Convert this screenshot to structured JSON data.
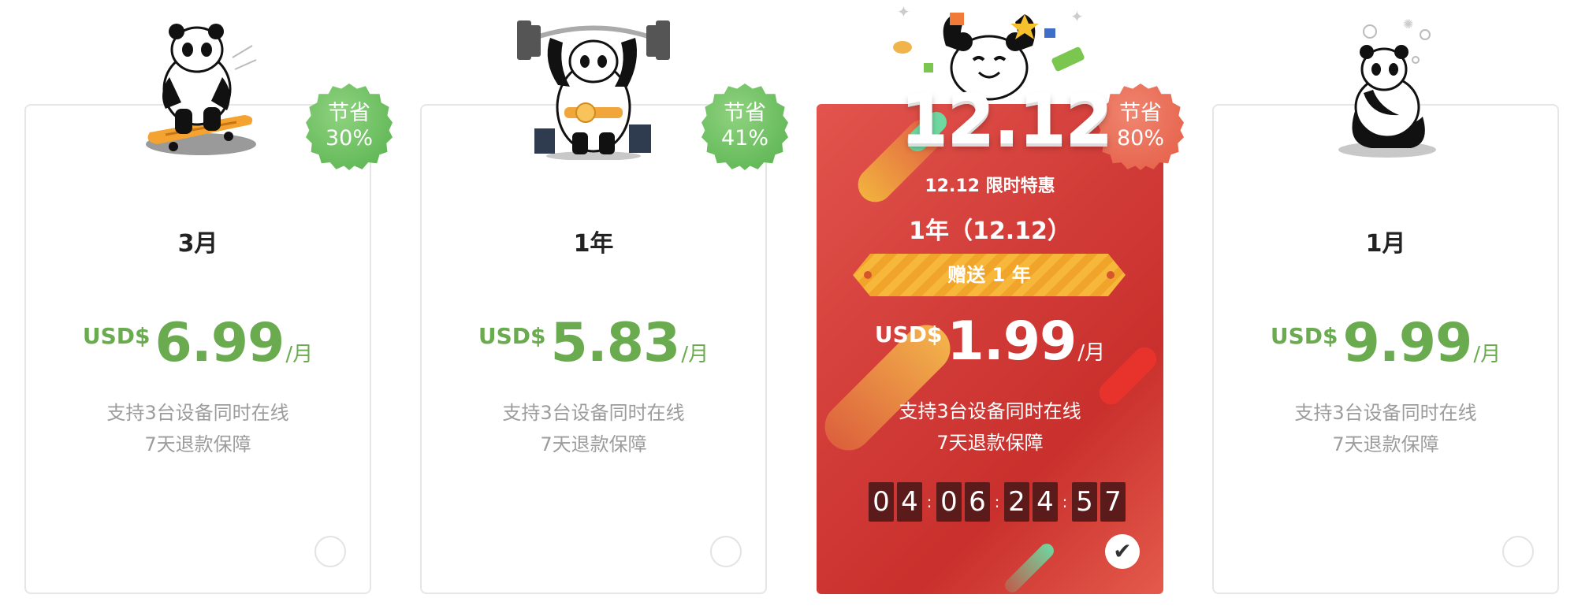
{
  "plans": [
    {
      "title": "3月",
      "currency": "USD$",
      "price": "6.99",
      "per": "/月",
      "features": [
        "支持3台设备同时在线",
        "7天退款保障"
      ],
      "badge": {
        "line1": "节省",
        "line2": "30%"
      },
      "selected": false
    },
    {
      "title": "1年",
      "currency": "USD$",
      "price": "5.83",
      "per": "/月",
      "features": [
        "支持3台设备同时在线",
        "7天退款保障"
      ],
      "badge": {
        "line1": "节省",
        "line2": "41%"
      },
      "selected": false
    },
    {
      "promo": "12.12 限时特惠",
      "title": "1年（12.12）",
      "gift": "赠送 1 年",
      "currency": "USD$",
      "price": "1.99",
      "per": "/月",
      "features": [
        "支持3台设备同时在线",
        "7天退款保障"
      ],
      "badge": {
        "line1": "节省",
        "line2": "80%"
      },
      "countdown": [
        "0",
        "4",
        "0",
        "6",
        "2",
        "4",
        "5",
        "7"
      ],
      "event_title": "12.12",
      "selected": true
    },
    {
      "title": "1月",
      "currency": "USD$",
      "price": "9.99",
      "per": "/月",
      "features": [
        "支持3台设备同时在线",
        "7天退款保障"
      ],
      "selected": false
    }
  ],
  "colors": {
    "price_green": "#6aab4f",
    "featured_red": "#d13b37",
    "badge_green": "#6cc05e",
    "badge_red": "#e86a52"
  },
  "icons": {
    "check": "✔"
  }
}
